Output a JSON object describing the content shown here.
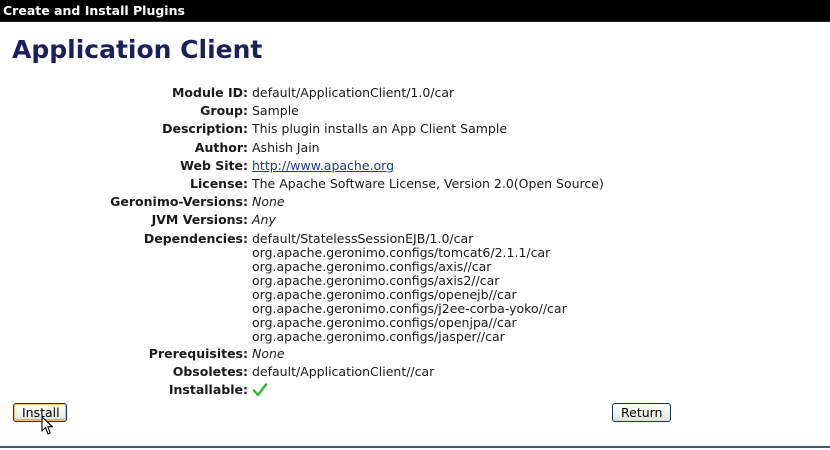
{
  "header": {
    "title": "Create and Install Plugins"
  },
  "page": {
    "title": "Application Client"
  },
  "details": {
    "module_id": {
      "label": "Module ID:",
      "value": "default/ApplicationClient/1.0/car"
    },
    "group": {
      "label": "Group:",
      "value": "Sample"
    },
    "description": {
      "label": "Description:",
      "value": "This plugin installs an App Client Sample"
    },
    "author": {
      "label": "Author:",
      "value": "Ashish Jain"
    },
    "web_site": {
      "label": "Web Site:",
      "value": "http://www.apache.org"
    },
    "license": {
      "label": "License:",
      "value": "The Apache Software License, Version 2.0(Open Source)"
    },
    "geronimo_versions": {
      "label": "Geronimo-Versions:",
      "value": "None"
    },
    "jvm_versions": {
      "label": "JVM Versions:",
      "value": "Any"
    },
    "dependencies": {
      "label": "Dependencies:",
      "items": [
        "default/StatelessSessionEJB/1.0/car",
        "org.apache.geronimo.configs/tomcat6/2.1.1/car",
        "org.apache.geronimo.configs/axis//car",
        "org.apache.geronimo.configs/axis2//car",
        "org.apache.geronimo.configs/openejb//car",
        "org.apache.geronimo.configs/j2ee-corba-yoko//car",
        "org.apache.geronimo.configs/openjpa//car",
        "org.apache.geronimo.configs/jasper//car"
      ]
    },
    "prerequisites": {
      "label": "Prerequisites:",
      "value": "None"
    },
    "obsoletes": {
      "label": "Obsoletes:",
      "value": "default/ApplicationClient//car"
    },
    "installable": {
      "label": "Installable:",
      "icon": "checkmark-icon",
      "icon_color": "#2fb52f"
    }
  },
  "actions": {
    "install_label": "Install",
    "return_label": "Return"
  },
  "colors": {
    "title": "#1c2058",
    "header_bg": "#000000",
    "link": "#1d3c8a",
    "check": "#2fb52f"
  }
}
